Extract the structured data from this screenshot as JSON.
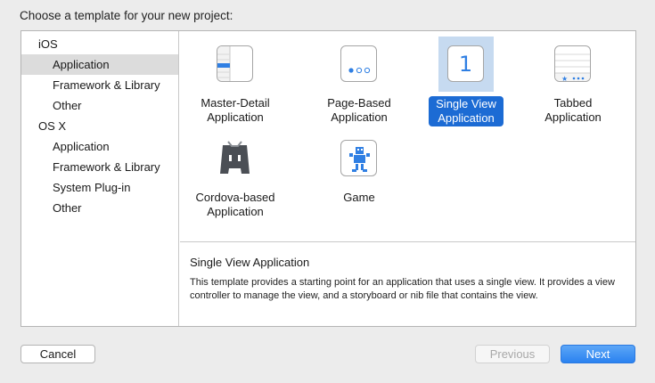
{
  "dialog": {
    "heading": "Choose a template for your new project:"
  },
  "sidebar": {
    "groups": [
      {
        "label": "iOS",
        "items": [
          {
            "label": "Application",
            "selected": true
          },
          {
            "label": "Framework & Library"
          },
          {
            "label": "Other"
          }
        ]
      },
      {
        "label": "OS X",
        "items": [
          {
            "label": "Application"
          },
          {
            "label": "Framework & Library"
          },
          {
            "label": "System Plug-in"
          },
          {
            "label": "Other"
          }
        ]
      }
    ]
  },
  "templates": [
    {
      "line1": "Master-Detail",
      "line2": "Application",
      "icon": "master-detail-icon"
    },
    {
      "line1": "Page-Based",
      "line2": "Application",
      "icon": "page-based-icon"
    },
    {
      "line1": "Single View",
      "line2": "Application",
      "icon": "single-view-icon",
      "selected": true,
      "icon_text": "1"
    },
    {
      "line1": "Tabbed",
      "line2": "Application",
      "icon": "tabbed-icon"
    },
    {
      "line1": "Cordova-based",
      "line2": "Application",
      "icon": "cordova-icon"
    },
    {
      "line1": "Game",
      "line2": "",
      "icon": "game-icon"
    }
  ],
  "description": {
    "title": "Single View Application",
    "text": "This template provides a starting point for an application that uses a single view. It provides a view controller to manage the view, and a storyboard or nib file that contains the view."
  },
  "buttons": {
    "cancel": "Cancel",
    "previous": "Previous",
    "next": "Next"
  },
  "colors": {
    "accent": "#1c6bd4",
    "selection_bg": "#c6daf0",
    "sidebar_selected": "#dcdcdc"
  }
}
